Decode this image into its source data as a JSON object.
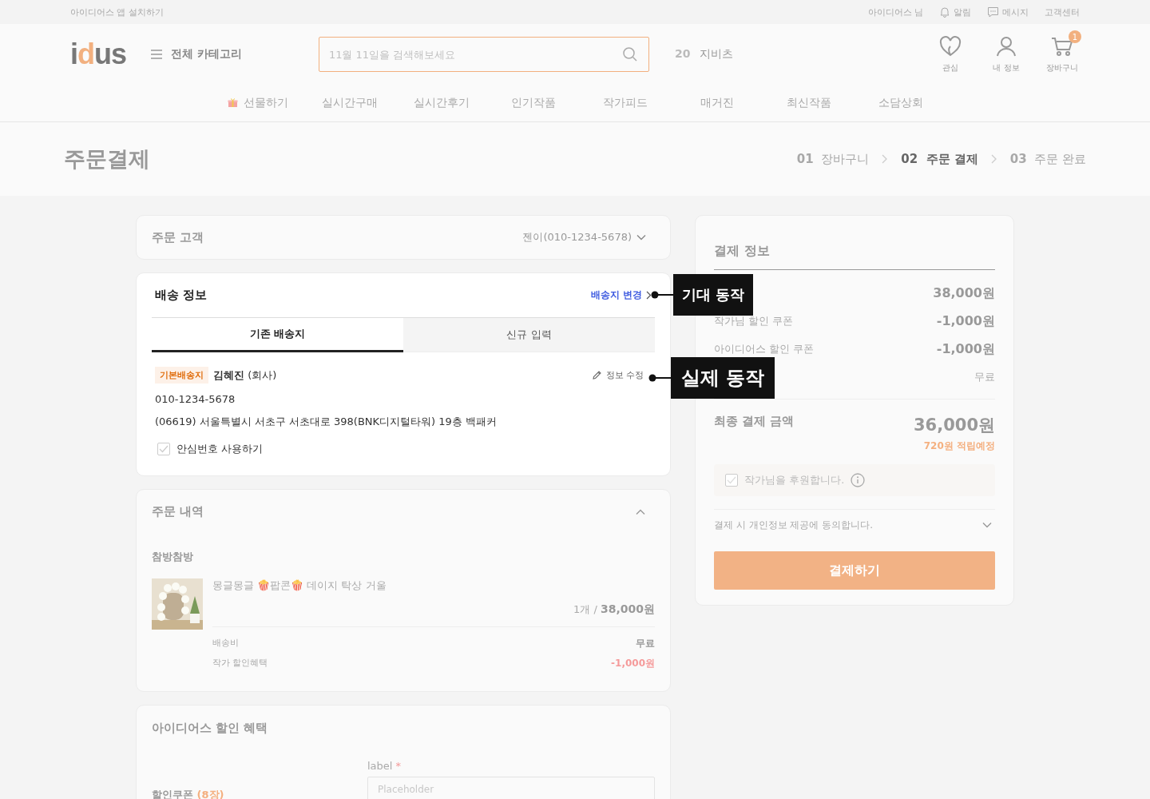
{
  "top_bar": {
    "app_install": "아이디어스 앱 설치하기",
    "user": "아이디어스 님",
    "links": [
      {
        "kind": "bell",
        "label": "알림"
      },
      {
        "kind": "message",
        "label": "메시지"
      },
      {
        "kind": "plain",
        "label": "고객센터"
      }
    ]
  },
  "header": {
    "logo": "idus",
    "category_button": "전체 카테고리",
    "search": {
      "placeholder": "11월 11일을 검색해보세요"
    },
    "trending": {
      "rank": "20",
      "keyword": "지비츠"
    },
    "icons": [
      {
        "kind": "heart",
        "label": "관심"
      },
      {
        "kind": "person",
        "label": "내 정보"
      },
      {
        "kind": "cart",
        "label": "장바구니",
        "badge": "1"
      }
    ]
  },
  "nav": [
    {
      "kind": "gift",
      "label": "선물하기"
    },
    {
      "kind": "plain",
      "label": "실시간구매"
    },
    {
      "kind": "plain",
      "label": "실시간후기"
    },
    {
      "kind": "plain",
      "label": "인기작품"
    },
    {
      "kind": "plain",
      "label": "작가피드"
    },
    {
      "kind": "plain",
      "label": "매거진"
    },
    {
      "kind": "plain",
      "label": "최신작품"
    },
    {
      "kind": "plain",
      "label": "소담상회"
    }
  ],
  "page": {
    "title": "주문결제",
    "steps": [
      {
        "number": "01",
        "label": "장바구니",
        "selected": false
      },
      {
        "number": "02",
        "label": "주문 결제",
        "selected": true
      },
      {
        "number": "03",
        "label": "주문 완료",
        "selected": false
      }
    ]
  },
  "customer": {
    "title": "주문 고객",
    "value": "젠이(010-1234-5678)"
  },
  "shipping": {
    "title": "배송 정보",
    "change_link": "배송지 변경",
    "tabs": [
      {
        "label": "기존 배송지",
        "selected": true
      },
      {
        "label": "신규 입력",
        "selected": false
      }
    ],
    "address": {
      "badge": "기본배송지",
      "name": "김혜진",
      "note": "(회사)",
      "edit": "정보 수정",
      "phone": "010-1234-5678",
      "address": "(06619) 서울특별시 서초구 서초대로 398(BNK디지털타워) 19층 백패커"
    },
    "safe_number": {
      "label": "안심번호 사용하기",
      "checked": false
    }
  },
  "order": {
    "title": "주문 내역",
    "expanded": true,
    "shop": "참방참방",
    "item": {
      "kind": "picture",
      "name": "몽글몽글 🍿팝콘🍿 데이지 탁상 거울",
      "quantity": "1개 /",
      "price": "38,000원"
    },
    "fees": [
      {
        "label": "배송비",
        "value": "무료",
        "kind": "plain"
      },
      {
        "label": "작가 할인혜택",
        "value": "-1,000원",
        "kind": "discount"
      }
    ]
  },
  "idus_discount": {
    "title": "아이디어스 할인 혜택",
    "coupon_label": "할인쿠폰",
    "coupon_count": "(8장)",
    "field": {
      "label": "label",
      "required": true,
      "required_mark": "*",
      "placeholder": "Placeholder"
    }
  },
  "summary": {
    "title": "결제 정보",
    "rows": [
      {
        "value": "38,000원",
        "kind": "amount"
      },
      {
        "label": "작가님 할인 쿠폰",
        "value": "-1,000원",
        "kind": "amount"
      },
      {
        "label": "아이디어스 할인 쿠폰",
        "value": "-1,000원",
        "kind": "amount"
      },
      {
        "value": "무료",
        "kind": "plain"
      }
    ],
    "total_label": "최종 결제 금액",
    "total_value": "36,000원",
    "points": "720원 적립예정",
    "support": {
      "label": "작가님을 후원합니다.",
      "checked": false
    },
    "agreement": {
      "label": "결제 시 개인정보 제공에 동의합니다.",
      "expanded": false
    },
    "pay_button": "결제하기"
  },
  "annotations": [
    {
      "kind": "expected",
      "text": "기대 동작"
    },
    {
      "kind": "actual",
      "text": "실제 동작"
    }
  ]
}
